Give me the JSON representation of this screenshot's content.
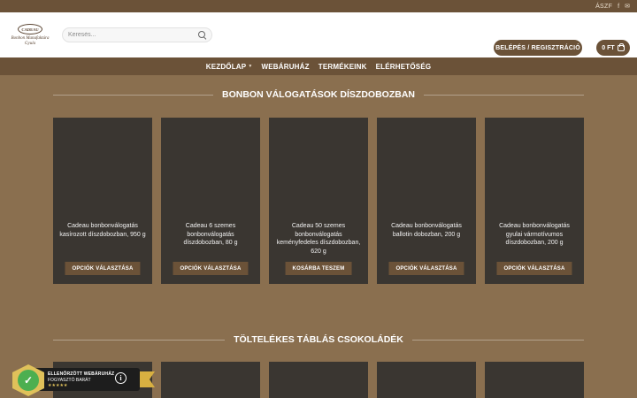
{
  "topbar": {
    "aszf": "ÁSZF",
    "facebook_icon": "f",
    "mail_icon": "✉"
  },
  "header": {
    "logo_badge": "CADEAU",
    "logo_script": "Bonbon Manufaktúra Gyula",
    "search_placeholder": "Keresés...",
    "login_label": "BELÉPÉS / REGISZTRÁCIÓ",
    "cart_label": "0 FT"
  },
  "nav": {
    "items": [
      {
        "label": "KEZDŐLAP",
        "has_dropdown": true
      },
      {
        "label": "WEBÁRUHÁZ"
      },
      {
        "label": "TERMÉKEINK"
      },
      {
        "label": "ELÉRHETŐSÉG"
      }
    ]
  },
  "sections": [
    {
      "title": "BONBON VÁLOGATÁSOK DÍSZDOBOZBAN",
      "products": [
        {
          "name": "Cadeau bonbonválogatás kasírozott díszdobozban, 950 g",
          "button": "OPCIÓK VÁLASZTÁSA"
        },
        {
          "name": "Cadeau 6 szemes bonbonválogatás díszdobozban, 80 g",
          "button": "OPCIÓK VÁLASZTÁSA"
        },
        {
          "name": "Cadeau 50 szemes bonbonválogatás keményfedeles díszdobozban, 620 g",
          "button": "KOSÁRBA TESZEM"
        },
        {
          "name": "Cadeau bonbonválogatás ballotin dobozban, 200 g",
          "button": "OPCIÓK VÁLASZTÁSA"
        },
        {
          "name": "Cadeau bonbonválogatás gyulai vármotívumos díszdobozban, 200 g",
          "button": "OPCIÓK VÁLASZTÁSA"
        }
      ]
    },
    {
      "title": "TÖLTELÉKES TÁBLÁS CSOKOLÁDÉK"
    }
  ],
  "trust_badge": {
    "line1": "ELLENŐRZÖTT WEBÁRUHÁZ",
    "line2": "FOGYASZTÓ BARÁT",
    "stars": "★★★★★",
    "info": "i"
  },
  "colors": {
    "brand_brown": "#6b5238",
    "page_bg": "#8a6f4f",
    "card_bg": "#3a3631"
  }
}
